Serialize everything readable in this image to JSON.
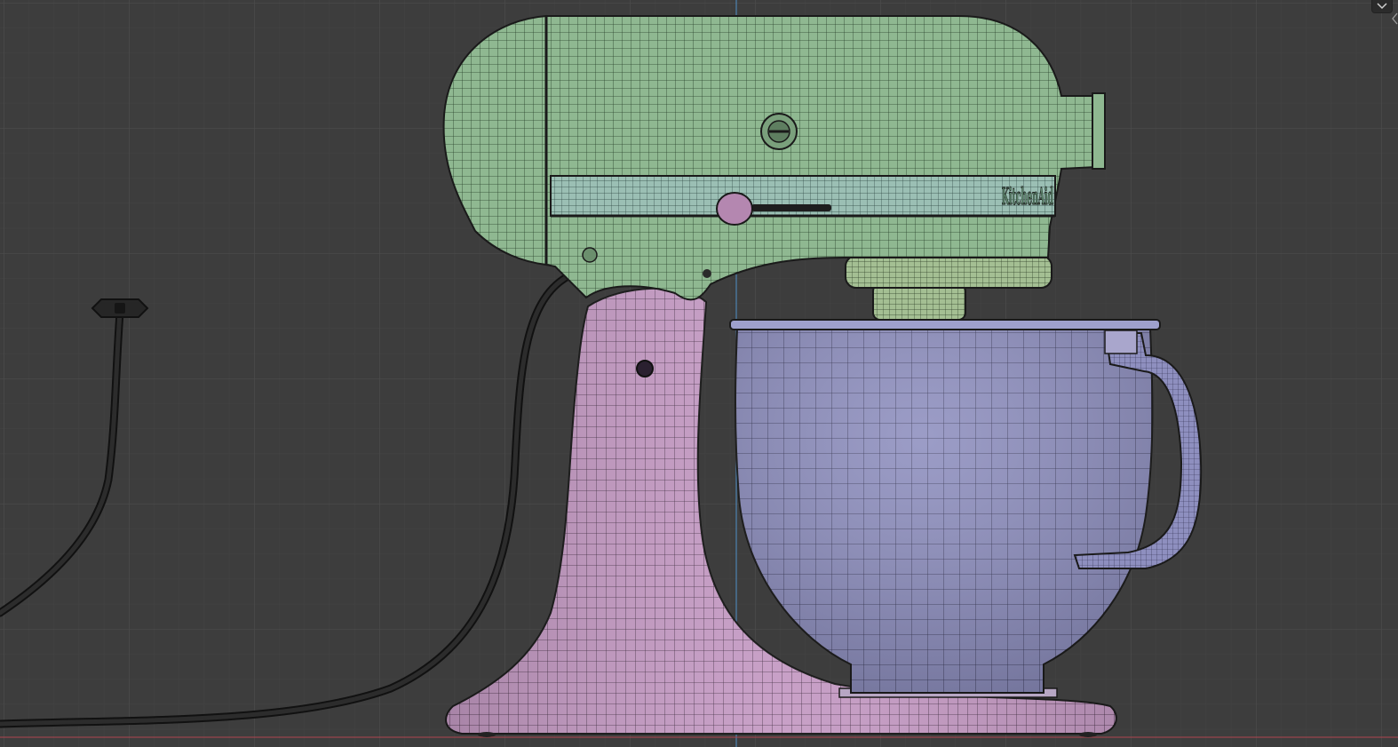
{
  "viewport": {
    "background": "#3d3d3d",
    "grid_minor_color": "#444444",
    "grid_major_color": "#4a4a4a",
    "vertical_axis_color": "#4f8fc6",
    "horizontal_axis_color": "#b0454f",
    "wireframe_color": "#1a1a1a"
  },
  "model": {
    "brand_text": "KitchenAid",
    "head_color": "#8fb891",
    "head_band_color": "#9bbfb4",
    "base_color": "#c59bc4",
    "bowl_color": "#8e8fbf",
    "cord_color": "#232323"
  },
  "header": {
    "toggle_icon": "chevron-down-icon"
  }
}
